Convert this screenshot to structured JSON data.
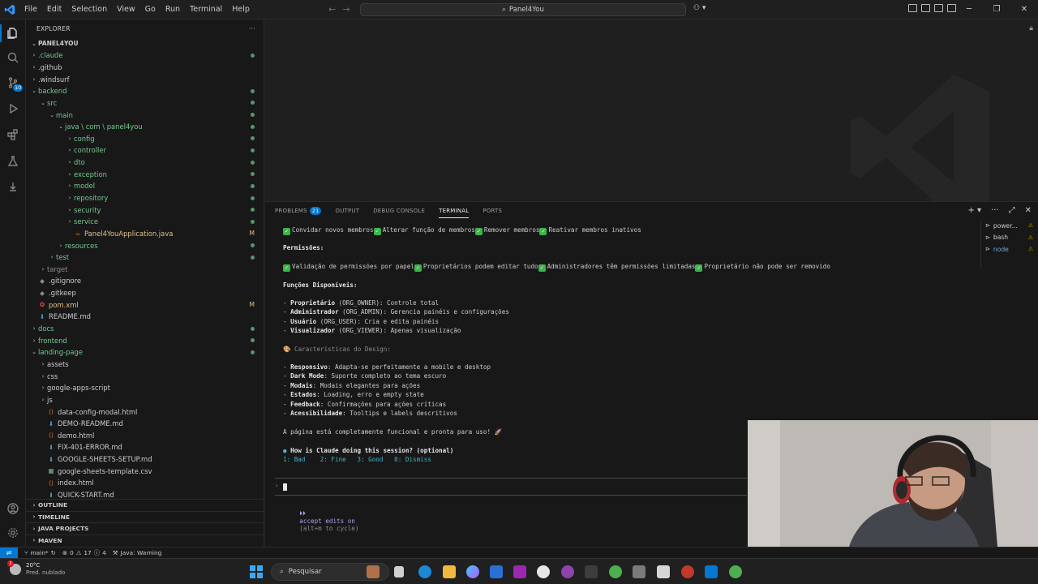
{
  "titlebar": {
    "menu": [
      "File",
      "Edit",
      "Selection",
      "View",
      "Go",
      "Run",
      "Terminal",
      "Help"
    ],
    "search": "Panel4You"
  },
  "activity_bar": {
    "scm_badge": "10"
  },
  "explorer": {
    "header": "EXPLORER",
    "project": "PANEL4YOU",
    "items": [
      {
        "label": ".claude",
        "depth": 0,
        "type": "folder",
        "open": false,
        "color": "green",
        "status": "dot"
      },
      {
        "label": ".github",
        "depth": 0,
        "type": "folder",
        "open": false,
        "color": "white",
        "status": ""
      },
      {
        "label": ".windsurf",
        "depth": 0,
        "type": "folder",
        "open": false,
        "color": "white",
        "status": ""
      },
      {
        "label": "backend",
        "depth": 0,
        "type": "folder",
        "open": true,
        "color": "green",
        "status": "dot"
      },
      {
        "label": "src",
        "depth": 1,
        "type": "folder",
        "open": true,
        "color": "green",
        "status": "dot"
      },
      {
        "label": "main",
        "depth": 2,
        "type": "folder",
        "open": true,
        "color": "green",
        "status": "dot"
      },
      {
        "label": "java \\ com \\ panel4you",
        "depth": 3,
        "type": "folder",
        "open": true,
        "color": "green",
        "status": "dot"
      },
      {
        "label": "config",
        "depth": 4,
        "type": "folder",
        "open": false,
        "color": "green",
        "status": "dot"
      },
      {
        "label": "controller",
        "depth": 4,
        "type": "folder",
        "open": false,
        "color": "green",
        "status": "dot"
      },
      {
        "label": "dto",
        "depth": 4,
        "type": "folder",
        "open": false,
        "color": "green",
        "status": "dot"
      },
      {
        "label": "exception",
        "depth": 4,
        "type": "folder",
        "open": false,
        "color": "green",
        "status": "dot"
      },
      {
        "label": "model",
        "depth": 4,
        "type": "folder",
        "open": false,
        "color": "green",
        "status": "dot"
      },
      {
        "label": "repository",
        "depth": 4,
        "type": "folder",
        "open": false,
        "color": "green",
        "status": "dot"
      },
      {
        "label": "security",
        "depth": 4,
        "type": "folder",
        "open": false,
        "color": "green",
        "status": "dot"
      },
      {
        "label": "service",
        "depth": 4,
        "type": "folder",
        "open": false,
        "color": "green",
        "status": "dot"
      },
      {
        "label": "Panel4YouApplication.java",
        "depth": 4,
        "type": "java",
        "open": false,
        "color": "yellow",
        "status": "M"
      },
      {
        "label": "resources",
        "depth": 3,
        "type": "folder",
        "open": false,
        "color": "green",
        "status": "dot"
      },
      {
        "label": "test",
        "depth": 2,
        "type": "folder",
        "open": false,
        "color": "green",
        "status": "dot"
      },
      {
        "label": "target",
        "depth": 1,
        "type": "folder",
        "open": false,
        "color": "gray",
        "status": ""
      },
      {
        "label": ".gitignore",
        "depth": 0,
        "type": "git",
        "open": false,
        "color": "white",
        "status": ""
      },
      {
        "label": ".gitkeep",
        "depth": 0,
        "type": "git",
        "open": false,
        "color": "white",
        "status": ""
      },
      {
        "label": "pom.xml",
        "depth": 0,
        "type": "xml",
        "open": false,
        "color": "yellow",
        "status": "M"
      },
      {
        "label": "README.md",
        "depth": 0,
        "type": "md",
        "open": false,
        "color": "white",
        "status": ""
      },
      {
        "label": "docs",
        "depth": 0,
        "type": "folder",
        "open": false,
        "color": "green",
        "status": "dot"
      },
      {
        "label": "frontend",
        "depth": 0,
        "type": "folder",
        "open": false,
        "color": "green",
        "status": "dot"
      },
      {
        "label": "landing-page",
        "depth": 0,
        "type": "folder",
        "open": true,
        "color": "green",
        "status": "dot"
      },
      {
        "label": "assets",
        "depth": 1,
        "type": "folder",
        "open": false,
        "color": "white",
        "status": ""
      },
      {
        "label": "css",
        "depth": 1,
        "type": "folder",
        "open": false,
        "color": "white",
        "status": ""
      },
      {
        "label": "google-apps-script",
        "depth": 1,
        "type": "folder",
        "open": false,
        "color": "white",
        "status": ""
      },
      {
        "label": "js",
        "depth": 1,
        "type": "folder",
        "open": false,
        "color": "white",
        "status": ""
      },
      {
        "label": "data-config-modal.html",
        "depth": 1,
        "type": "html",
        "open": false,
        "color": "white",
        "status": ""
      },
      {
        "label": "DEMO-README.md",
        "depth": 1,
        "type": "md",
        "open": false,
        "color": "white",
        "status": ""
      },
      {
        "label": "demo.html",
        "depth": 1,
        "type": "html",
        "open": false,
        "color": "white",
        "status": ""
      },
      {
        "label": "FIX-401-ERROR.md",
        "depth": 1,
        "type": "md",
        "open": false,
        "color": "white",
        "status": ""
      },
      {
        "label": "GOOGLE-SHEETS-SETUP.md",
        "depth": 1,
        "type": "md",
        "open": false,
        "color": "white",
        "status": ""
      },
      {
        "label": "google-sheets-template.csv",
        "depth": 1,
        "type": "csv",
        "open": false,
        "color": "white",
        "status": ""
      },
      {
        "label": "index.html",
        "depth": 1,
        "type": "html",
        "open": false,
        "color": "white",
        "status": ""
      },
      {
        "label": "QUICK-START.md",
        "depth": 1,
        "type": "md",
        "open": false,
        "color": "white",
        "status": ""
      }
    ],
    "sections": [
      "OUTLINE",
      "TIMELINE",
      "JAVA PROJECTS",
      "MAVEN"
    ]
  },
  "panel": {
    "tabs": [
      {
        "label": "PROBLEMS",
        "badge": "21",
        "active": false
      },
      {
        "label": "OUTPUT",
        "badge": "",
        "active": false
      },
      {
        "label": "DEBUG CONSOLE",
        "badge": "",
        "active": false
      },
      {
        "label": "TERMINAL",
        "badge": "",
        "active": true
      },
      {
        "label": "PORTS",
        "badge": "",
        "active": false
      }
    ],
    "terminals": [
      {
        "label": "power...",
        "selected": false
      },
      {
        "label": "bash",
        "selected": false
      },
      {
        "label": "node",
        "selected": true
      }
    ]
  },
  "terminal": {
    "line1": [
      "Convidar novos membros",
      "Alterar função de membros",
      "Remover membros",
      "Reativar membros inativos"
    ],
    "permissions_title": "Permissões:",
    "line2": [
      "Validação de permissões por papel",
      "Proprietários podem editar tudo",
      "Administradores têm permissões limitadas",
      "Proprietário não pode ser removido"
    ],
    "roles_title": "Funções Disponíveis:",
    "roles": [
      {
        "name": "Proprietário",
        "desc": " (ORG_OWNER): Controle total"
      },
      {
        "name": "Administrador",
        "desc": " (ORG_ADMIN): Gerencia painéis e configurações"
      },
      {
        "name": "Usuário",
        "desc": " (ORG_USER): Cria e edita painéis"
      },
      {
        "name": "Visualizador",
        "desc": " (ORG_VIEWER): Apenas visualização"
      }
    ],
    "design_title": "🎨 Características do Design:",
    "design": [
      {
        "name": "Responsivo",
        "desc": ": Adapta-se perfeitamente a mobile e desktop"
      },
      {
        "name": "Dark Mode",
        "desc": ": Suporte completo ao tema escuro"
      },
      {
        "name": "Modais",
        "desc": ": Modais elegantes para ações"
      },
      {
        "name": "Estados",
        "desc": ": Loading, erro e empty state"
      },
      {
        "name": "Feedback",
        "desc": ": Confirmações para ações críticas"
      },
      {
        "name": "Acessibilidade",
        "desc": ": Tooltips e labels descritivos"
      }
    ],
    "final_line": "A página está completamente funcional e pronta para uso! 🚀",
    "feedback_q": "How is Claude doing this session? (optional)",
    "feedback_opts": "1: Bad    2: Fine   3: Good   0: Dismiss",
    "accept_label": "accept edits on",
    "accept_hint": "(alt+m to cycle)"
  },
  "statusbar": {
    "branch": "main*",
    "errors": "0",
    "warnings": "17",
    "infos": "4",
    "java": "Java: Warning"
  },
  "taskbar": {
    "temperature": "20°C",
    "weather": "Pred. nublado",
    "search_placeholder": "Pesquisar",
    "notification_count": "1"
  }
}
